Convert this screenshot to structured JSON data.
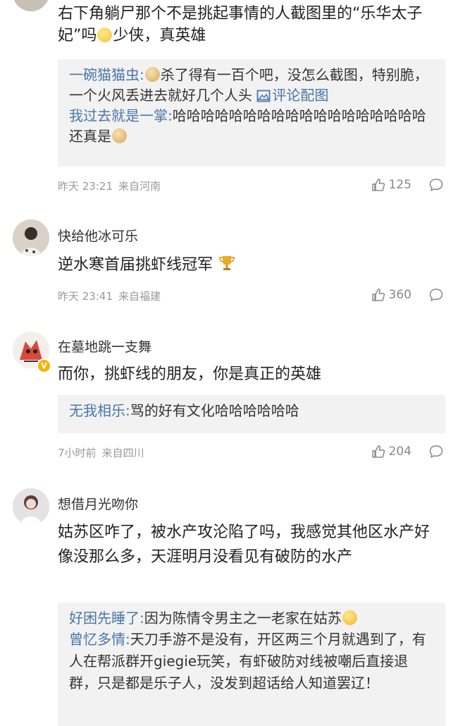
{
  "comments": [
    {
      "text": "右下角躺尸那个不是挑起事情的人截图里的“乐华太子妃”吗",
      "text_after_emoji": "少侠，真英雄",
      "replies": [
        {
          "name": "一碗猫猫虫:",
          "text": "杀了得有一百个吧，没怎么截图，特别脆，一个火风丢进去就好几个人头",
          "link": "评论配图"
        },
        {
          "name": "我过去就是一掌:",
          "text": "哈哈哈哈哈哈哈哈哈哈哈哈哈哈哈哈哈哈还真是"
        }
      ],
      "time": "昨天 23:21",
      "source": "来自河南",
      "likes": "125"
    },
    {
      "username": "快给他冰可乐",
      "text": "逆水寒首届挑虾线冠军",
      "time": "昨天 23:41",
      "source": "来自福建",
      "likes": "360"
    },
    {
      "username": "在墓地跳一支舞",
      "text": "而你，挑虾线的朋友，你是真正的英雄",
      "replies": [
        {
          "name": "无我相乐:",
          "text": "骂的好有文化哈哈哈哈哈哈"
        }
      ],
      "time": "7小时前",
      "source": "来自四川",
      "likes": "204"
    },
    {
      "username": "想借月光吻你",
      "text": "姑苏区咋了，被水产攻沦陷了吗，我感觉其他区水产好像没那么多，天涯明月没看见有破防的水产",
      "replies": [
        {
          "name": "好困先睡了:",
          "text": "因为陈情令男主之一老家在姑苏"
        },
        {
          "name": "曾忆多情:",
          "text": "天刀手游不是没有，开区两三个月就遇到了，有人在帮派群开giegie玩笑，有虾破防对线被嘲后直接退群，只是都是乐子人，没发到超话给人知道罢辽！"
        }
      ]
    }
  ],
  "colors": {
    "link": "#4a76a8",
    "reply_bg": "#f2f2f2",
    "meta": "#999999"
  }
}
